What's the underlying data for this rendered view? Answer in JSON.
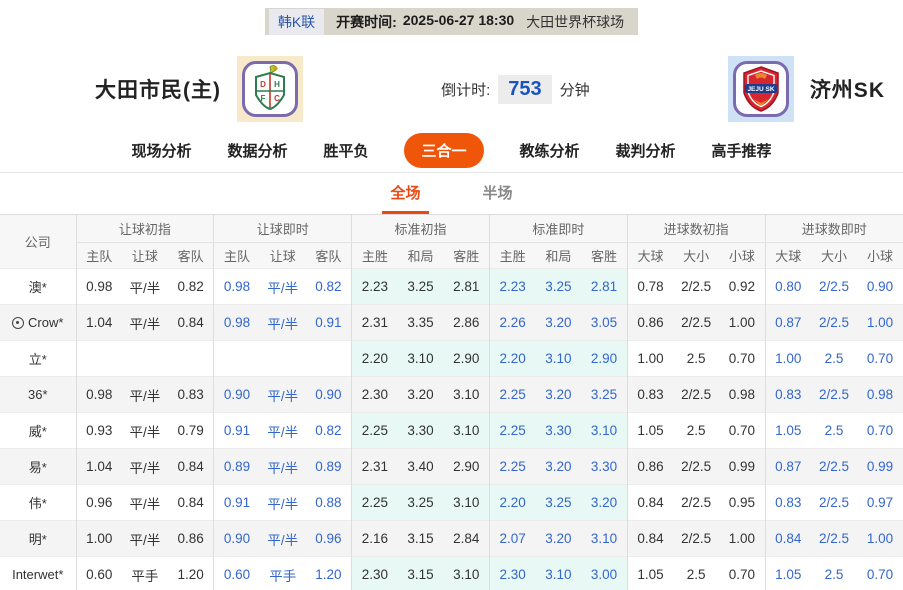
{
  "topbar": {
    "league": "韩K联",
    "kickoff_label": "开赛时间:",
    "kickoff_time": "2025-06-27 18:30",
    "venue": "大田世界杯球场"
  },
  "header": {
    "home_team": "大田市民(主)",
    "home_logo_letters": [
      "D",
      "H",
      "F",
      "C"
    ],
    "away_logo_text": "JEJU SK",
    "away_team": "济州SK",
    "countdown_label": "倒计时:",
    "countdown_value": "753",
    "countdown_unit": "分钟"
  },
  "nav": {
    "items": [
      {
        "label": "现场分析",
        "active": false
      },
      {
        "label": "数据分析",
        "active": false
      },
      {
        "label": "胜平负",
        "active": false
      },
      {
        "label": "三合一",
        "active": true
      },
      {
        "label": "教练分析",
        "active": false
      },
      {
        "label": "裁判分析",
        "active": false
      },
      {
        "label": "高手推荐",
        "active": false
      }
    ]
  },
  "subtabs": [
    {
      "label": "全场",
      "active": true
    },
    {
      "label": "半场",
      "active": false
    }
  ],
  "colors": {
    "accent_orange": "#f0560a",
    "subtab_red": "#e84a17",
    "live_blue": "#3366cc",
    "std_column_bg": "#e8f8f5"
  },
  "icons": {
    "company_marker": "football-icon"
  },
  "table": {
    "company_header": "公司",
    "groups": [
      {
        "label": "让球初指",
        "cols": [
          "主队",
          "让球",
          "客队"
        ]
      },
      {
        "label": "让球即时",
        "cols": [
          "主队",
          "让球",
          "客队"
        ]
      },
      {
        "label": "标准初指",
        "cols": [
          "主胜",
          "和局",
          "客胜"
        ]
      },
      {
        "label": "标准即时",
        "cols": [
          "主胜",
          "和局",
          "客胜"
        ]
      },
      {
        "label": "进球数初指",
        "cols": [
          "大球",
          "大小",
          "小球"
        ]
      },
      {
        "label": "进球数即时",
        "cols": [
          "大球",
          "大小",
          "小球"
        ]
      }
    ],
    "rows": [
      {
        "company": "澳*",
        "has_icon": false,
        "handicap_initial": [
          "0.98",
          "平/半",
          "0.82"
        ],
        "handicap_live": [
          "0.98",
          "平/半",
          "0.82"
        ],
        "std_initial": [
          "2.23",
          "3.25",
          "2.81"
        ],
        "std_live": [
          "2.23",
          "3.25",
          "2.81"
        ],
        "goals_initial": [
          "0.78",
          "2/2.5",
          "0.92"
        ],
        "goals_live": [
          "0.80",
          "2/2.5",
          "0.90"
        ]
      },
      {
        "company": "Crow*",
        "has_icon": true,
        "handicap_initial": [
          "1.04",
          "平/半",
          "0.84"
        ],
        "handicap_live": [
          "0.98",
          "平/半",
          "0.91"
        ],
        "std_initial": [
          "2.31",
          "3.35",
          "2.86"
        ],
        "std_live": [
          "2.26",
          "3.20",
          "3.05"
        ],
        "goals_initial": [
          "0.86",
          "2/2.5",
          "1.00"
        ],
        "goals_live": [
          "0.87",
          "2/2.5",
          "1.00"
        ]
      },
      {
        "company": "立*",
        "has_icon": false,
        "handicap_initial": [
          "",
          "",
          ""
        ],
        "handicap_live": [
          "",
          "",
          ""
        ],
        "std_initial": [
          "2.20",
          "3.10",
          "2.90"
        ],
        "std_live": [
          "2.20",
          "3.10",
          "2.90"
        ],
        "goals_initial": [
          "1.00",
          "2.5",
          "0.70"
        ],
        "goals_live": [
          "1.00",
          "2.5",
          "0.70"
        ]
      },
      {
        "company": "36*",
        "has_icon": false,
        "handicap_initial": [
          "0.98",
          "平/半",
          "0.83"
        ],
        "handicap_live": [
          "0.90",
          "平/半",
          "0.90"
        ],
        "std_initial": [
          "2.30",
          "3.20",
          "3.10"
        ],
        "std_live": [
          "2.25",
          "3.20",
          "3.25"
        ],
        "goals_initial": [
          "0.83",
          "2/2.5",
          "0.98"
        ],
        "goals_live": [
          "0.83",
          "2/2.5",
          "0.98"
        ]
      },
      {
        "company": "威*",
        "has_icon": false,
        "handicap_initial": [
          "0.93",
          "平/半",
          "0.79"
        ],
        "handicap_live": [
          "0.91",
          "平/半",
          "0.82"
        ],
        "std_initial": [
          "2.25",
          "3.30",
          "3.10"
        ],
        "std_live": [
          "2.25",
          "3.30",
          "3.10"
        ],
        "goals_initial": [
          "1.05",
          "2.5",
          "0.70"
        ],
        "goals_live": [
          "1.05",
          "2.5",
          "0.70"
        ]
      },
      {
        "company": "易*",
        "has_icon": false,
        "handicap_initial": [
          "1.04",
          "平/半",
          "0.84"
        ],
        "handicap_live": [
          "0.89",
          "平/半",
          "0.89"
        ],
        "std_initial": [
          "2.31",
          "3.40",
          "2.90"
        ],
        "std_live": [
          "2.25",
          "3.20",
          "3.30"
        ],
        "goals_initial": [
          "0.86",
          "2/2.5",
          "0.99"
        ],
        "goals_live": [
          "0.87",
          "2/2.5",
          "0.99"
        ]
      },
      {
        "company": "伟*",
        "has_icon": false,
        "handicap_initial": [
          "0.96",
          "平/半",
          "0.84"
        ],
        "handicap_live": [
          "0.91",
          "平/半",
          "0.88"
        ],
        "std_initial": [
          "2.25",
          "3.25",
          "3.10"
        ],
        "std_live": [
          "2.20",
          "3.25",
          "3.20"
        ],
        "goals_initial": [
          "0.84",
          "2/2.5",
          "0.95"
        ],
        "goals_live": [
          "0.83",
          "2/2.5",
          "0.97"
        ]
      },
      {
        "company": "明*",
        "has_icon": false,
        "handicap_initial": [
          "1.00",
          "平/半",
          "0.86"
        ],
        "handicap_live": [
          "0.90",
          "平/半",
          "0.96"
        ],
        "std_initial": [
          "2.16",
          "3.15",
          "2.84"
        ],
        "std_live": [
          "2.07",
          "3.20",
          "3.10"
        ],
        "goals_initial": [
          "0.84",
          "2/2.5",
          "1.00"
        ],
        "goals_live": [
          "0.84",
          "2/2.5",
          "1.00"
        ]
      },
      {
        "company": "Interwet*",
        "has_icon": false,
        "handicap_initial": [
          "0.60",
          "平手",
          "1.20"
        ],
        "handicap_live": [
          "0.60",
          "平手",
          "1.20"
        ],
        "std_initial": [
          "2.30",
          "3.15",
          "3.10"
        ],
        "std_live": [
          "2.30",
          "3.10",
          "3.00"
        ],
        "goals_initial": [
          "1.05",
          "2.5",
          "0.70"
        ],
        "goals_live": [
          "1.05",
          "2.5",
          "0.70"
        ]
      }
    ]
  }
}
